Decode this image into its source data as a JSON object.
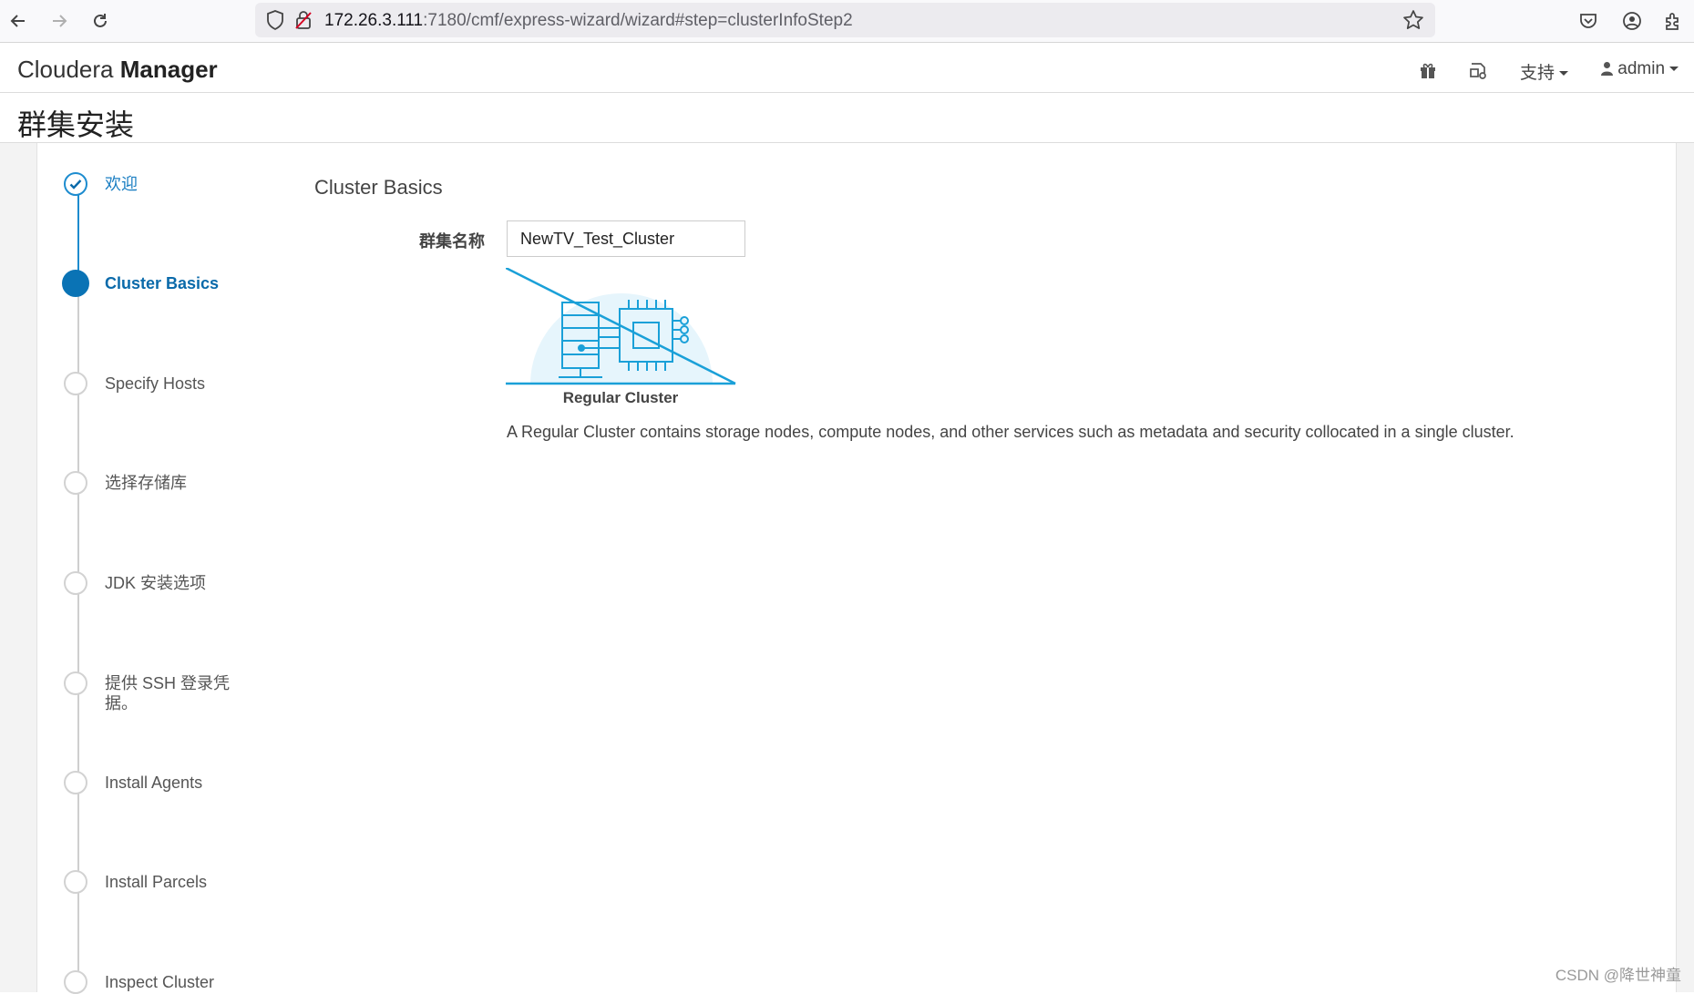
{
  "browser": {
    "url_host": "172.26.3.111",
    "url_path": ":7180/cmf/express-wizard/wizard#step=clusterInfoStep2"
  },
  "header": {
    "brand_light": "Cloudera",
    "brand_bold": "Manager",
    "support_label": "支持",
    "user_label": "admin"
  },
  "page": {
    "title": "群集安装"
  },
  "steps": [
    {
      "label": "欢迎",
      "state": "done"
    },
    {
      "label": "Cluster Basics",
      "state": "active"
    },
    {
      "label": "Specify Hosts",
      "state": "pending"
    },
    {
      "label": "选择存储库",
      "state": "pending"
    },
    {
      "label": "JDK 安装选项",
      "state": "pending"
    },
    {
      "label": "提供 SSH 登录凭据。",
      "state": "pending"
    },
    {
      "label": "Install Agents",
      "state": "pending"
    },
    {
      "label": "Install Parcels",
      "state": "pending"
    },
    {
      "label": "Inspect Cluster",
      "state": "pending"
    }
  ],
  "main": {
    "section_title": "Cluster Basics",
    "cluster_name_label": "群集名称",
    "cluster_name_value": "NewTV_Test_Cluster",
    "cluster_type_name": "Regular Cluster",
    "cluster_type_desc": "A Regular Cluster contains storage nodes, compute nodes, and other services such as metadata and security collocated in a single cluster."
  },
  "watermark": "CSDN @降世神童",
  "colors": {
    "accent": "#0a73b5",
    "illustration": "#1aa0d8"
  }
}
